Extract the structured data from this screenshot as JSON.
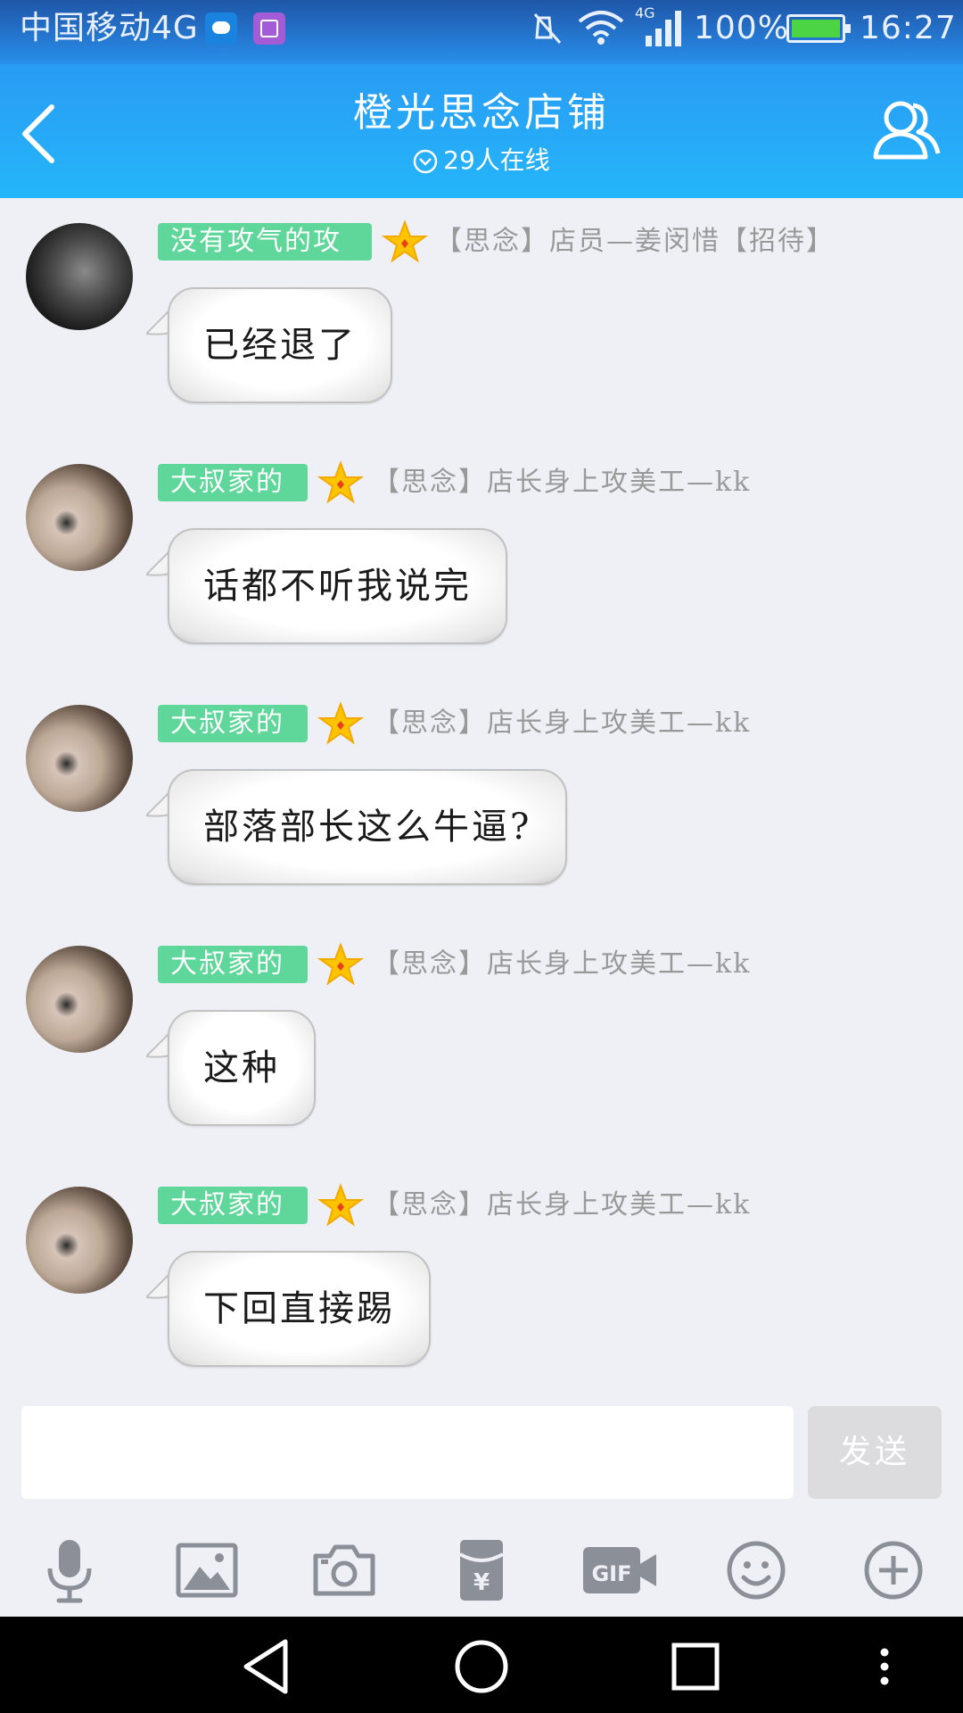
{
  "status_bar": {
    "carrier": "中国移动4G",
    "network": "4G",
    "battery_percent": "100%",
    "time": "16:27",
    "icons": [
      "chat-notify-icon",
      "image-notify-icon",
      "mute-icon",
      "wifi-icon",
      "signal-icon",
      "battery-icon"
    ]
  },
  "header": {
    "title": "橙光思念店铺",
    "online_count": "29人在线",
    "back_icon": "chevron-left-icon",
    "members_icon": "members-icon"
  },
  "messages": [
    {
      "sender": "没有攻气的攻",
      "title": "【思念】店员—姜闵惜【招待】",
      "text": "已经退了"
    },
    {
      "sender": "大叔家的",
      "title": "【思念】店长身上攻美工—kk",
      "text": "话都不听我说完"
    },
    {
      "sender": "大叔家的",
      "title": "【思念】店长身上攻美工—kk",
      "text": "部落部长这么牛逼?"
    },
    {
      "sender": "大叔家的",
      "title": "【思念】店长身上攻美工—kk",
      "text": "这种"
    },
    {
      "sender": "大叔家的",
      "title": "【思念】店长身上攻美工—kk",
      "text": "下回直接踢"
    }
  ],
  "input": {
    "value": "",
    "placeholder": "",
    "send_label": "发送"
  },
  "toolbar": {
    "items": [
      "microphone-icon",
      "image-icon",
      "camera-icon",
      "red-packet-icon",
      "gif-icon",
      "emoji-icon",
      "plus-icon"
    ]
  },
  "colors": {
    "header_blue": "#27a6f6",
    "name_tag_green": "#5fd69a",
    "star_gold": "#ffc400",
    "title_gray": "#999999",
    "background": "#eef0f6"
  }
}
